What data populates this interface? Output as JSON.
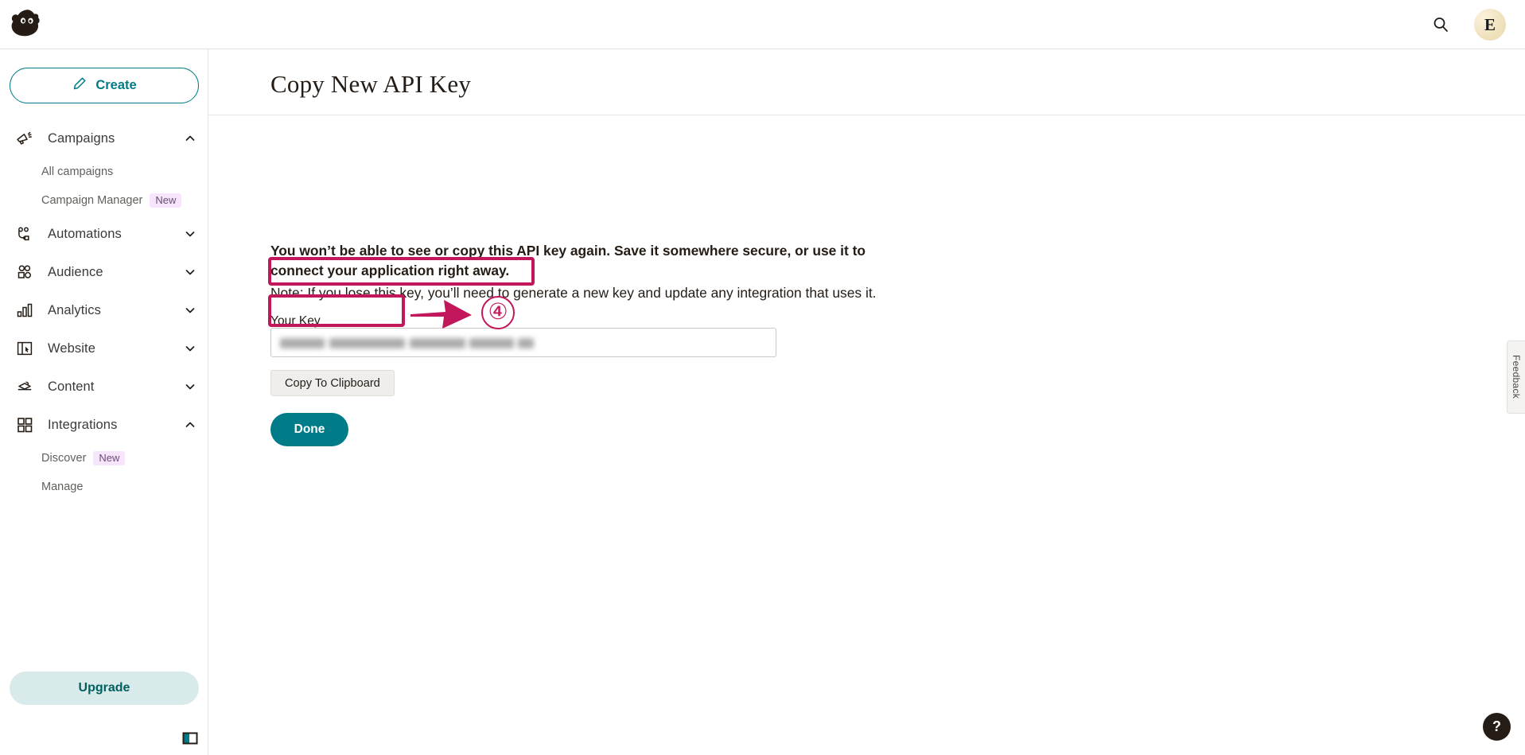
{
  "topbar": {
    "logo_icon": "mailchimp-freddie-logo",
    "search_icon": "search-icon",
    "avatar_initial": "E"
  },
  "sidebar": {
    "create_label": "Create",
    "create_icon": "pencil-icon",
    "upgrade_label": "Upgrade",
    "panel_toggle_icon": "sidebar-panel-toggle-icon",
    "items": [
      {
        "label": "Campaigns",
        "icon": "megaphone-icon",
        "chevron": "chevron-up-icon",
        "expanded": true,
        "children": [
          {
            "label": "All campaigns",
            "badge": ""
          },
          {
            "label": "Campaign Manager",
            "badge": "New"
          }
        ]
      },
      {
        "label": "Automations",
        "icon": "automations-flow-icon",
        "chevron": "chevron-down-icon",
        "expanded": false,
        "children": []
      },
      {
        "label": "Audience",
        "icon": "people-icon",
        "chevron": "chevron-down-icon",
        "expanded": false,
        "children": []
      },
      {
        "label": "Analytics",
        "icon": "bar-chart-icon",
        "chevron": "chevron-down-icon",
        "expanded": false,
        "children": []
      },
      {
        "label": "Website",
        "icon": "browser-window-icon",
        "chevron": "chevron-down-icon",
        "expanded": false,
        "children": []
      },
      {
        "label": "Content",
        "icon": "content-stack-icon",
        "chevron": "chevron-down-icon",
        "expanded": false,
        "children": []
      },
      {
        "label": "Integrations",
        "icon": "grid-squares-icon",
        "chevron": "chevron-up-icon",
        "expanded": true,
        "children": [
          {
            "label": "Discover",
            "badge": "New"
          },
          {
            "label": "Manage",
            "badge": ""
          }
        ]
      }
    ]
  },
  "main": {
    "page_title": "Copy New API Key",
    "warning_text": "You won’t be able to see or copy this API key again. Save it somewhere secure, or use it to connect your application right away.",
    "note_text": "Note: If you lose this key, you’ll need to generate a new key and update any integration that uses it.",
    "key_label": "Your Key",
    "key_value": "",
    "key_placeholder": "",
    "key_redacted": true,
    "copy_button_label": "Copy To Clipboard",
    "done_button_label": "Done"
  },
  "annotations": {
    "accent_color": "#c2175b",
    "step_number": "④",
    "arrow_icon": "right-arrow-annotation-icon",
    "highlight_targets": [
      "your-key-input",
      "copy-to-clipboard-button"
    ]
  },
  "utility": {
    "feedback_label": "Feedback",
    "help_label": "?"
  },
  "colors": {
    "brand_teal": "#007c89",
    "upgrade_bg": "#d9eaea",
    "annotation_pink": "#c2175b",
    "badge_new_bg": "#f7e6fb"
  }
}
